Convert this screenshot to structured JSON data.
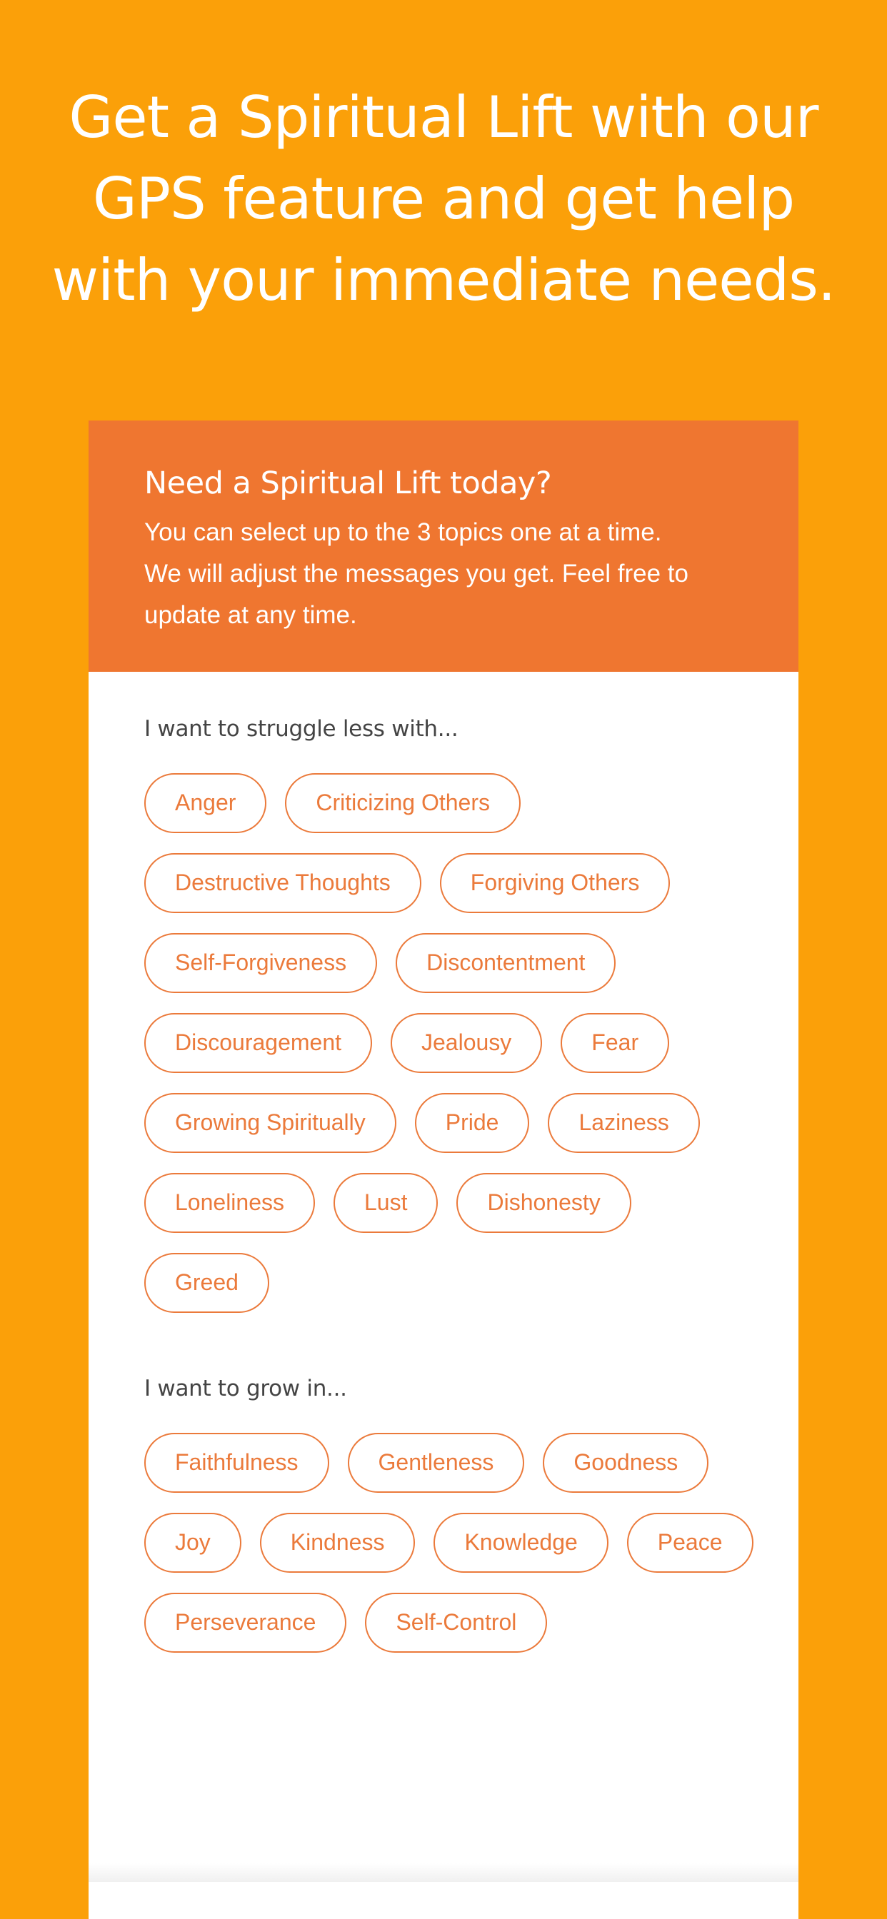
{
  "hero": {
    "title_lines": [
      "Get a Spiritual Lift with our",
      "GPS feature and get help",
      "with your immediate needs."
    ]
  },
  "card": {
    "title": "Need a Spiritual Lift today?",
    "description_lines": [
      "You can select up to the 3 topics one at a time.",
      "We will adjust the messages you get. Feel free to",
      "update at any time."
    ]
  },
  "struggle": {
    "label": "I want to struggle less with...",
    "topics": [
      "Anger",
      "Criticizing Others",
      "Destructive Thoughts",
      "Forgiving Others",
      "Self-Forgiveness",
      "Discontentment",
      "Discouragement",
      "Jealousy",
      "Fear",
      "Growing Spiritually",
      "Pride",
      "Laziness",
      "Loneliness",
      "Lust",
      "Dishonesty",
      "Greed"
    ]
  },
  "grow": {
    "label": "I want to grow in...",
    "topics": [
      "Faithfulness",
      "Gentleness",
      "Goodness",
      "Joy",
      "Kindness",
      "Knowledge",
      "Peace",
      "Perseverance",
      "Self-Control"
    ]
  },
  "colors": {
    "background": "#FBA009",
    "header": "#EF7630",
    "chip": "#EB7A3B"
  }
}
